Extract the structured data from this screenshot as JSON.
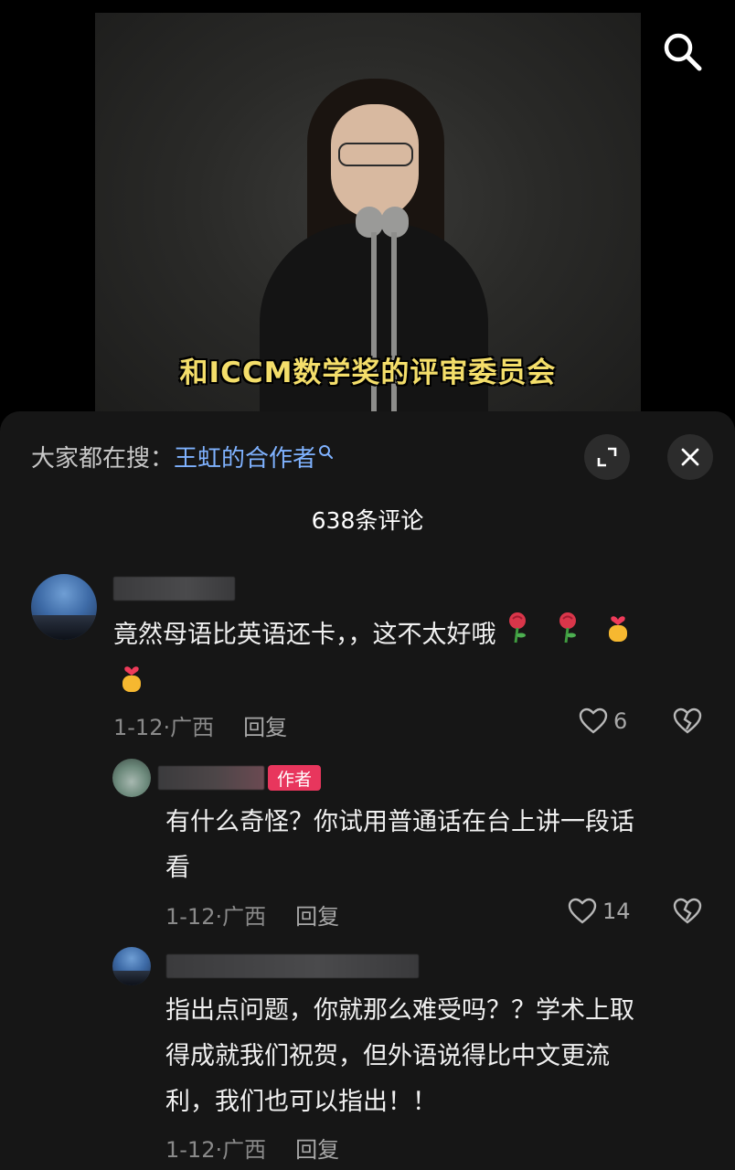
{
  "video": {
    "subtitle": "和ICCM数学奖的评审委员会"
  },
  "top_bar": {
    "search_icon": "search-icon"
  },
  "hot_search": {
    "prefix": "大家都在搜：",
    "term": "王虹的合作者",
    "term_icon": "search-icon",
    "expand_icon": "expand-icon",
    "close_icon": "close-icon"
  },
  "comments_header": {
    "count_label": "638条评论"
  },
  "comments": [
    {
      "text": "竟然母语比英语还卡，，这不太好哦",
      "emojis": [
        "rose-emoji",
        "rose-emoji",
        "finger-heart-emoji",
        "finger-heart-emoji"
      ],
      "meta": "1-12·广西",
      "reply_label": "回复",
      "likes": "6"
    },
    {
      "author_tag": "作者",
      "text_line1": "有什么奇怪？你试用普通话在台上讲一段话",
      "text_line2": "看",
      "meta": "1-12·广西",
      "reply_label": "回复",
      "likes": "14"
    },
    {
      "text_line1": "指出点问题，你就那么难受吗？？学术上取",
      "text_line2": "得成就我们祝贺，但外语说得比中文更流",
      "text_line3": "利，我们也可以指出！！",
      "meta": "1-12·广西",
      "reply_label": "回复"
    }
  ],
  "colors": {
    "panel": "#161616",
    "hot_term": "#7fb2ff",
    "author_tag": "#e8365d",
    "subtitle": "#f4de6a"
  }
}
